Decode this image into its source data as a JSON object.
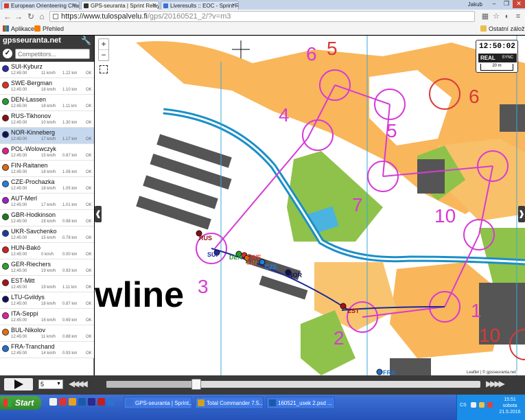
{
  "browser": {
    "tabs": [
      {
        "title": "European Orienteering Cham",
        "favicon_color": "#d23b2a"
      },
      {
        "title": "GPS-seuranta | Sprint Relay",
        "favicon_color": "#333333"
      },
      {
        "title": "Liveresults :: EOC - Sprint Re",
        "favicon_color": "#3b6fd2"
      }
    ],
    "user": "Jakub",
    "url_host": "https://www.tulospalvelu.fi",
    "url_path": "/gps/20160521_2/?v=m3",
    "bookmarks": {
      "apps": "Aplikace",
      "overview": "Přehled",
      "other": "Ostatní záložky"
    }
  },
  "sidebar": {
    "title": "gpsseuranta.net",
    "search_placeholder": "Competitors...",
    "runners": [
      {
        "name": "SUI-Kyburz",
        "time": "12:45:00",
        "speed": "11 km/h",
        "dist": "1.22 km",
        "status": "OK",
        "color": "#2a2aa8"
      },
      {
        "name": "SWE-Bergman",
        "time": "12:45:00",
        "speed": "18 km/h",
        "dist": "1.10 km",
        "status": "OK",
        "color": "#e03020"
      },
      {
        "name": "DEN-Lassen",
        "time": "12:45:00",
        "speed": "18 km/h",
        "dist": "1.11 km",
        "status": "OK",
        "color": "#2a9a30"
      },
      {
        "name": "RUS-Tikhonov",
        "time": "12:45:00",
        "speed": "10 km/h",
        "dist": "1.30 km",
        "status": "OK",
        "color": "#8a0e0e"
      },
      {
        "name": "NOR-Kinneberg",
        "time": "12:45:00",
        "speed": "17 km/h",
        "dist": "1.17 km",
        "status": "OK",
        "color": "#10105a",
        "selected": true
      },
      {
        "name": "POL-Wolowczyk",
        "time": "12:45:00",
        "speed": "15 km/h",
        "dist": "0.87 km",
        "status": "OK",
        "color": "#e0208a"
      },
      {
        "name": "FIN-Raitanen",
        "time": "12:45:00",
        "speed": "18 km/h",
        "dist": "1.06 km",
        "status": "OK",
        "color": "#e06a10"
      },
      {
        "name": "CZE-Prochazka",
        "time": "12:45:00",
        "speed": "18 km/h",
        "dist": "1.05 km",
        "status": "OK",
        "color": "#2080e0"
      },
      {
        "name": "AUT-Merl",
        "time": "12:45:00",
        "speed": "17 km/h",
        "dist": "1.01 km",
        "status": "OK",
        "color": "#9a20c8"
      },
      {
        "name": "GBR-Hodkinson",
        "time": "12:45:00",
        "speed": "18 km/h",
        "dist": "0.98 km",
        "status": "OK",
        "color": "#1a7a20"
      },
      {
        "name": "UKR-Savchenko",
        "time": "12:45:00",
        "speed": "15 km/h",
        "dist": "0.78 km",
        "status": "OK",
        "color": "#1a3aa8"
      },
      {
        "name": "HUN-Bakó",
        "time": "12:45:00",
        "speed": "0 km/h",
        "dist": "0.00 km",
        "status": "OK",
        "color": "#d02020"
      },
      {
        "name": "GER-Riechers",
        "time": "12:45:00",
        "speed": "19 km/h",
        "dist": "0.93 km",
        "status": "OK",
        "color": "#30a030"
      },
      {
        "name": "EST-Mitt",
        "time": "12:45:00",
        "speed": "19 km/h",
        "dist": "1.11 km",
        "status": "OK",
        "color": "#b01010"
      },
      {
        "name": "LTU-Gvildys",
        "time": "12:45:00",
        "speed": "18 km/h",
        "dist": "0.87 km",
        "status": "OK",
        "color": "#101060"
      },
      {
        "name": "ITA-Seppi",
        "time": "12:45:00",
        "speed": "16 km/h",
        "dist": "0.69 km",
        "status": "OK",
        "color": "#e020a0"
      },
      {
        "name": "BUL-Nikolov",
        "time": "12:45:00",
        "speed": "11 km/h",
        "dist": "0.88 km",
        "status": "OK",
        "color": "#e07010"
      },
      {
        "name": "FRA-Tranchand",
        "time": "12:45:00",
        "speed": "14 km/h",
        "dist": "0.93 km",
        "status": "OK",
        "color": "#2070d0"
      }
    ]
  },
  "map": {
    "zoom_in": "+",
    "zoom_out": "−",
    "clock": "12:50:02",
    "real_label": "REAL",
    "sync_label": "SYNC",
    "scale_label": "20 m",
    "attribution": "Leaflet | © gpsseuranta.net",
    "controls_pink": [
      "6",
      "4",
      "5",
      "7",
      "10",
      "3",
      "2",
      "1"
    ],
    "controls_red": [
      "5",
      "6",
      "10"
    ],
    "map_text": "wline",
    "runner_labels": [
      "RUS",
      "SUI",
      "DEN",
      "SWE",
      "FIN",
      "CZE",
      "NOR",
      "EST",
      "FRA"
    ]
  },
  "playback": {
    "speed": "5",
    "progress": 0.24
  },
  "taskbar": {
    "start": "Start",
    "tasks": [
      {
        "title": "GPS-seuranta | Sprint...",
        "color": "#3b6fd2"
      },
      {
        "title": "Total Commander 7.5...",
        "color": "#d0a020"
      },
      {
        "title": "160521_usek 2.psd ...",
        "color": "#1a5aa8"
      }
    ],
    "lang": "CS",
    "time": "15:51",
    "day": "sobota",
    "date": "21.5.2016"
  }
}
